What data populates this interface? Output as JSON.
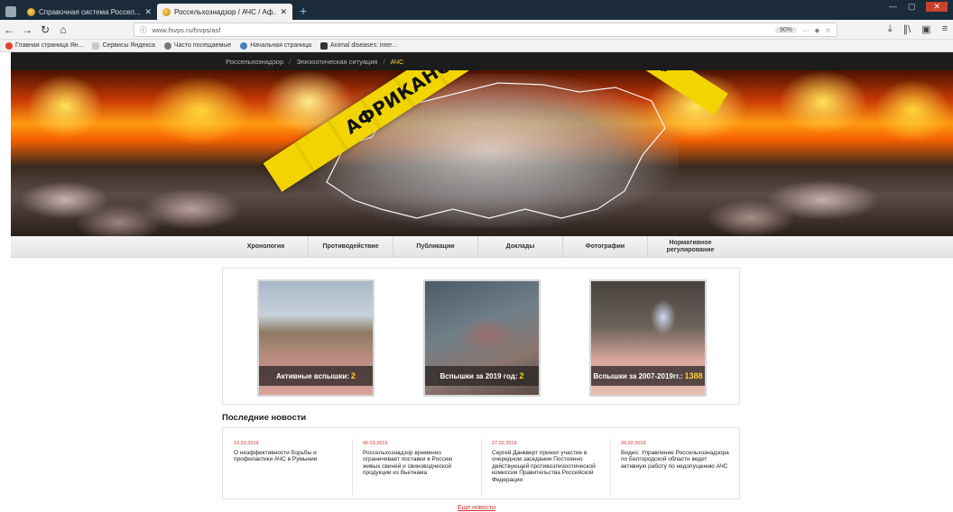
{
  "browser": {
    "tabs": [
      {
        "title": "Справочная система Россел...",
        "active": false
      },
      {
        "title": "Россельхознадзор / АЧС / Аф...",
        "active": true
      }
    ],
    "new_tab": "+",
    "url": "www.fsvps.ru/fsvps/asf",
    "zoom": "90%",
    "bookmarks": [
      "Главная страница Ян...",
      "Сервисы Яндекса",
      "Часто посещаемые",
      "Начальная страница",
      "Animal diseases: inter..."
    ]
  },
  "breadcrumb": {
    "items": [
      "Россельхознадзор",
      "Эпизоотическая ситуация",
      "АЧС"
    ],
    "separator": "/"
  },
  "banner": {
    "tape_text": "АФРИКАНСКАЯ ЧУМА СВИНЕЙ",
    "tape_text_small": "АФ"
  },
  "menu": {
    "items": [
      "Хронология",
      "Противодействие",
      "Публикации",
      "Доклады",
      "Фотографии",
      "Нормативное регулирование"
    ]
  },
  "stats": [
    {
      "label": "Активные вспышки:",
      "value": "2"
    },
    {
      "label": "Вспышки за 2019 год:",
      "value": "2"
    },
    {
      "label": "Вспышки за 2007-2019гг.:",
      "value": "1388"
    }
  ],
  "news": {
    "title": "Последние новости",
    "items": [
      {
        "date": "13.03.2019",
        "text": "О неэффективности борьбы и профилактики АЧС в Румынии"
      },
      {
        "date": "06.03.2019",
        "text": "Россельхознадзор временно ограничивает поставки в Россию живых свиней и свиноводческой продукции из Вьетнама"
      },
      {
        "date": "27.02.2019",
        "text": "Сергей Данкверт принял участие в очередном заседании Постоянно действующей противоэпизоотической комиссии Правительства Российской Федерации"
      },
      {
        "date": "26.02.2019",
        "text": "Видео: Управление Россельхознадзора по Белгородской области ведет активную работу по недопущению АЧС"
      }
    ],
    "more": "Еще новости"
  }
}
